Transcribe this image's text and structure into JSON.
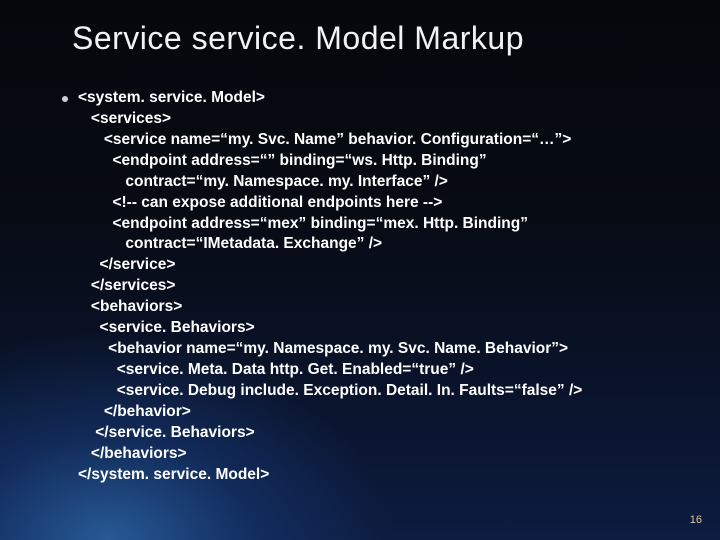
{
  "title": "Service service. Model Markup",
  "code_lines": [
    "<system. service. Model>",
    "   <services>",
    "      <service name=“my. Svc. Name” behavior. Configuration=“…”>",
    "        <endpoint address=“” binding=“ws. Http. Binding”",
    "           contract=“my. Namespace. my. Interface” />",
    "        <!-- can expose additional endpoints here -->",
    "        <endpoint address=“mex” binding=“mex. Http. Binding”",
    "           contract=“IMetadata. Exchange” />",
    "     </service>",
    "   </services>",
    "   <behaviors>",
    "     <service. Behaviors>",
    "       <behavior name=“my. Namespace. my. Svc. Name. Behavior”>",
    "         <service. Meta. Data http. Get. Enabled=“true” />",
    "         <service. Debug include. Exception. Detail. In. Faults=“false” />",
    "      </behavior>",
    "    </service. Behaviors>",
    "   </behaviors>",
    "</system. service. Model>"
  ],
  "page_number": "16"
}
